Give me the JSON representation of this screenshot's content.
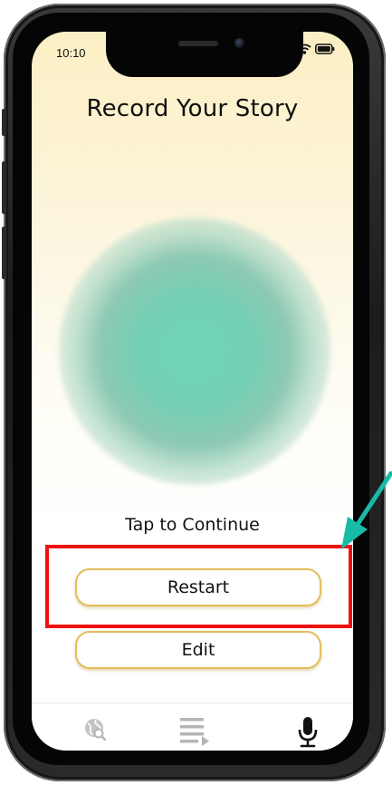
{
  "status_bar": {
    "time": "10:10"
  },
  "screen": {
    "title": "Record Your Story",
    "prompt": "Tap to Continue"
  },
  "buttons": {
    "restart": "Restart",
    "edit": "Edit"
  },
  "tab_bar": {
    "items": [
      {
        "icon": "globe-search-icon",
        "active": false
      },
      {
        "icon": "playlist-icon",
        "active": false
      },
      {
        "icon": "microphone-icon",
        "active": true
      }
    ]
  },
  "colors": {
    "background_top": "#fbefc4",
    "orb": "#6fd6b8",
    "button_border": "#e2bd5a",
    "highlight": "#ee1111",
    "arrow": "#17bba6",
    "inactive_icon": "#b5b5b5",
    "active_icon": "#111111"
  }
}
